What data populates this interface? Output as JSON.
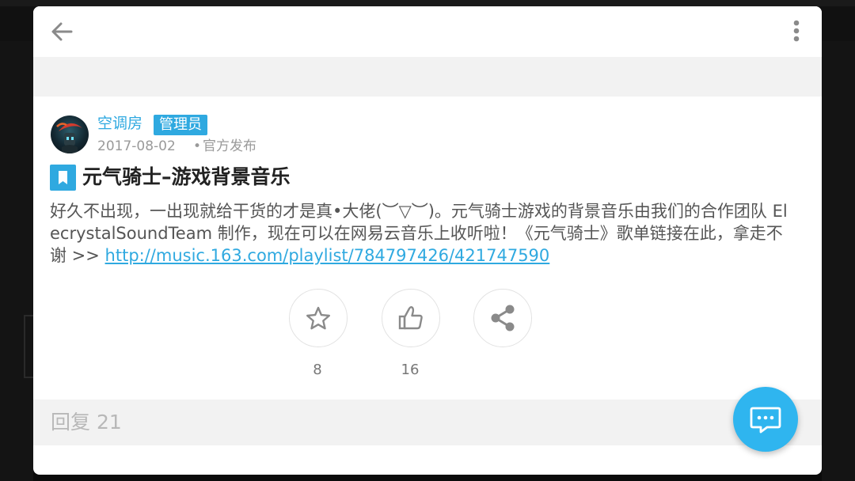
{
  "header": {
    "back_icon": "arrow-left-icon",
    "more_icon": "more-vertical-icon"
  },
  "post": {
    "author": "空调房",
    "badge": "管理员",
    "date": "2017-08-02",
    "separator": "•",
    "post_type": "官方发布",
    "title": "元气骑士–游戏背景音乐",
    "body_text": "好久不出现，一出现就给干货的才是真•大佬(︶▽︶)。元气骑士游戏的背景音乐由我们的合作团队 ElecrystalSoundTeam 制作，现在可以在网易云音乐上收听啦！《元气骑士》歌单链接在此，拿走不谢 >> ",
    "link_text": "http://music.163.com/playlist/784797426/421747590"
  },
  "actions": {
    "favorite": {
      "icon": "star-icon",
      "count": "8"
    },
    "like": {
      "icon": "thumbs-up-icon",
      "count": "16"
    },
    "share": {
      "icon": "share-icon"
    }
  },
  "replies": {
    "label": "回复 21"
  },
  "fab": {
    "icon": "comment-icon"
  },
  "colors": {
    "accent": "#2fa9e0",
    "fab": "#2fb5ef",
    "band": "#f2f2f2"
  }
}
